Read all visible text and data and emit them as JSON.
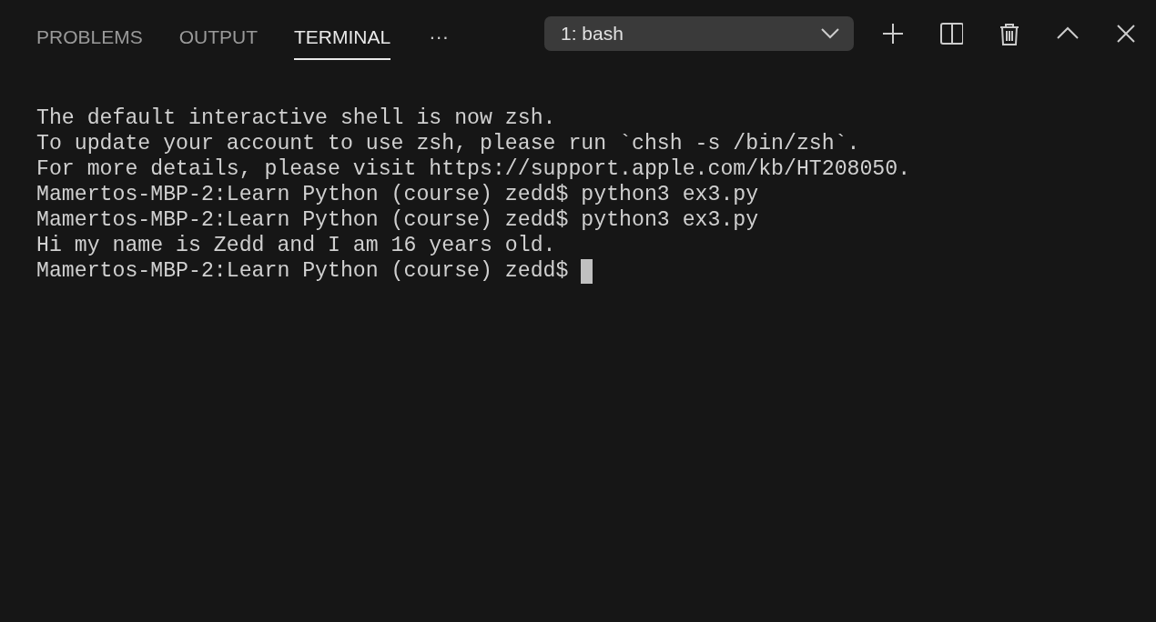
{
  "tabs": [
    {
      "label": "PROBLEMS",
      "selected": false
    },
    {
      "label": "OUTPUT",
      "selected": false
    },
    {
      "label": "TERMINAL",
      "selected": true
    }
  ],
  "more": "···",
  "terminal_select": {
    "value": "1: bash"
  },
  "toolbar": [
    {
      "kind": "plus"
    },
    {
      "kind": "split"
    },
    {
      "kind": "trash"
    },
    {
      "kind": "chevron-up"
    },
    {
      "kind": "close"
    }
  ],
  "terminal": {
    "lines": [
      "The default interactive shell is now zsh.",
      "To update your account to use zsh, please run `chsh -s /bin/zsh`.",
      "For more details, please visit https://support.apple.com/kb/HT208050.",
      "Mamertos-MBP-2:Learn Python (course) zedd$ python3 ex3.py",
      "Mamertos-MBP-2:Learn Python (course) zedd$ python3 ex3.py",
      "Hi my name is Zedd and I am 16 years old.",
      "Mamertos-MBP-2:Learn Python (course) zedd$"
    ],
    "cursor": true
  }
}
